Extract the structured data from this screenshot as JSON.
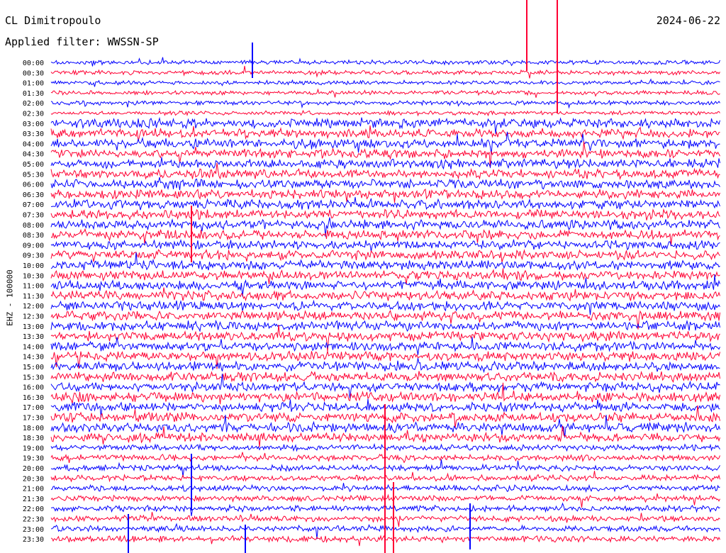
{
  "header": {
    "station": "CL Dimitropoulo",
    "filter_label": "Applied filter: WWSSN-SP",
    "date": "2024-06-22"
  },
  "channel_label": "EHZ - 100000",
  "chart_data": {
    "type": "line",
    "title": "CL Dimitropoulo",
    "date": "2024-06-22",
    "filter": "WWSSN-SP",
    "channel": "EHZ",
    "scale": "100000",
    "rows": [
      "00:00",
      "00:30",
      "01:00",
      "01:30",
      "02:00",
      "02:30",
      "03:00",
      "03:30",
      "04:00",
      "04:30",
      "05:00",
      "05:30",
      "06:00",
      "06:30",
      "07:00",
      "07:30",
      "08:00",
      "08:30",
      "09:00",
      "09:30",
      "10:00",
      "10:30",
      "11:00",
      "11:30",
      "12:00",
      "12:30",
      "13:00",
      "13:30",
      "14:00",
      "14:30",
      "15:00",
      "15:30",
      "16:00",
      "16:30",
      "17:00",
      "17:30",
      "18:00",
      "18:30",
      "19:00",
      "19:30",
      "20:00",
      "20:30",
      "21:00",
      "21:30",
      "22:00",
      "22:30",
      "23:00",
      "23:30"
    ],
    "row_minutes": 30,
    "colors": [
      "#0000ff",
      "#ff0033"
    ],
    "grid": false
  }
}
